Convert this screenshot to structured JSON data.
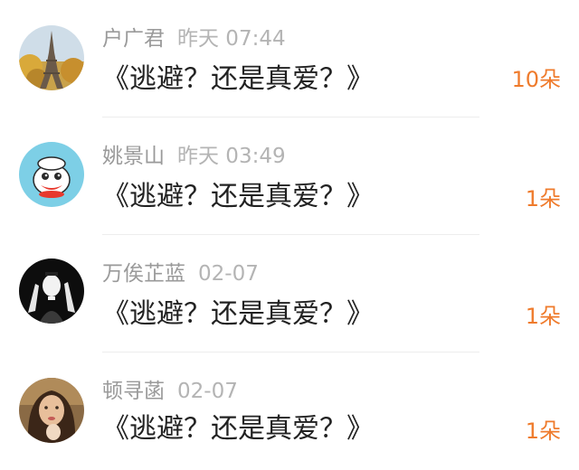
{
  "messages": [
    {
      "name": "户广君",
      "time": "昨天 07:44",
      "title": "《逃避？还是真爱？》",
      "count": "10朵",
      "avatar_icon": "eiffel-tower-avatar"
    },
    {
      "name": "姚景山",
      "time": "昨天 03:49",
      "title": "《逃避？还是真爱？》",
      "count": "1朵",
      "avatar_icon": "cartoon-monkey-avatar"
    },
    {
      "name": "万俟芷蓝",
      "time": "02-07",
      "title": "《逃避？还是真爱？》",
      "count": "1朵",
      "avatar_icon": "mime-avatar"
    },
    {
      "name": "顿寻菡",
      "time": "02-07",
      "title": "《逃避？还是真爱？》",
      "count": "1朵",
      "avatar_icon": "woman-portrait-avatar"
    }
  ],
  "colors": {
    "name": "#9a9a9a",
    "time": "#b4b4b4",
    "title": "#222222",
    "count": "#ef7b2c",
    "divider": "#ededed"
  }
}
